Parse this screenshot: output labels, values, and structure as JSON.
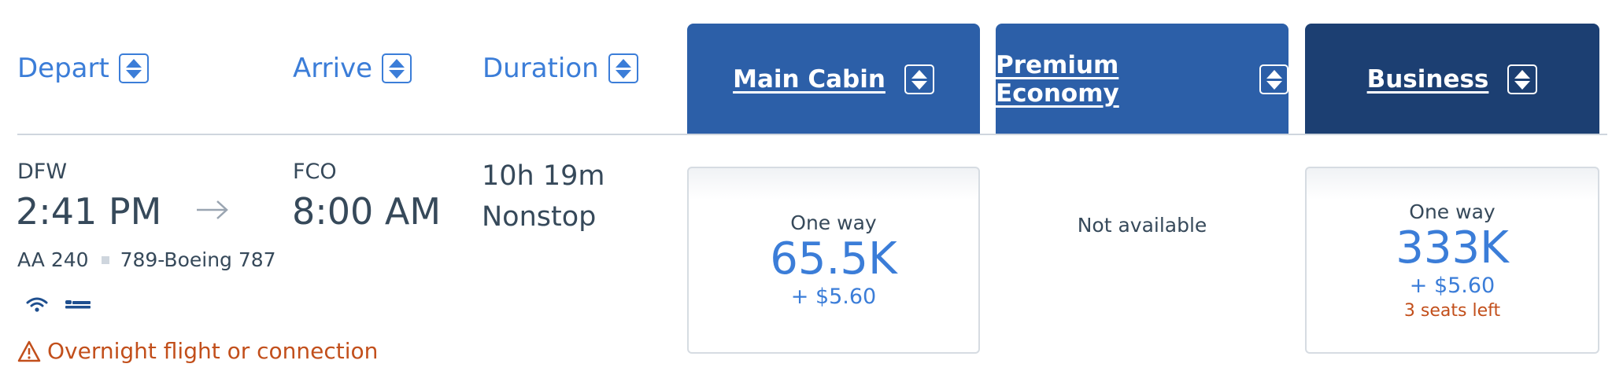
{
  "headers": {
    "depart": "Depart",
    "arrive": "Arrive",
    "duration": "Duration"
  },
  "cabins": [
    {
      "label": "Main Cabin",
      "color": "#2c5fa8"
    },
    {
      "label": "Premium Economy",
      "color": "#2c5fa8"
    },
    {
      "label": "Business",
      "color": "#1c3f72"
    }
  ],
  "flight": {
    "origin": "DFW",
    "depart_time": "2:41 PM",
    "destination": "FCO",
    "arrive_time": "8:00 AM",
    "duration": "10h 19m",
    "stops": "Nonstop",
    "flight_number": "AA 240",
    "aircraft": "789-Boeing 787",
    "amenities": [
      "wifi-icon",
      "lie-flat-seat-icon"
    ],
    "warning": "Overnight flight or connection"
  },
  "fares": {
    "main": {
      "label": "One way",
      "miles": "65.5K",
      "tax": "+ $5.60"
    },
    "premium": {
      "status": "Not available"
    },
    "business": {
      "label": "One way",
      "miles": "333K",
      "tax": "+ $5.60",
      "seats_left": "3 seats left"
    }
  },
  "colors": {
    "link_blue": "#3b7dd8",
    "warning_orange": "#c24f1b",
    "text_dark": "#36495a"
  }
}
